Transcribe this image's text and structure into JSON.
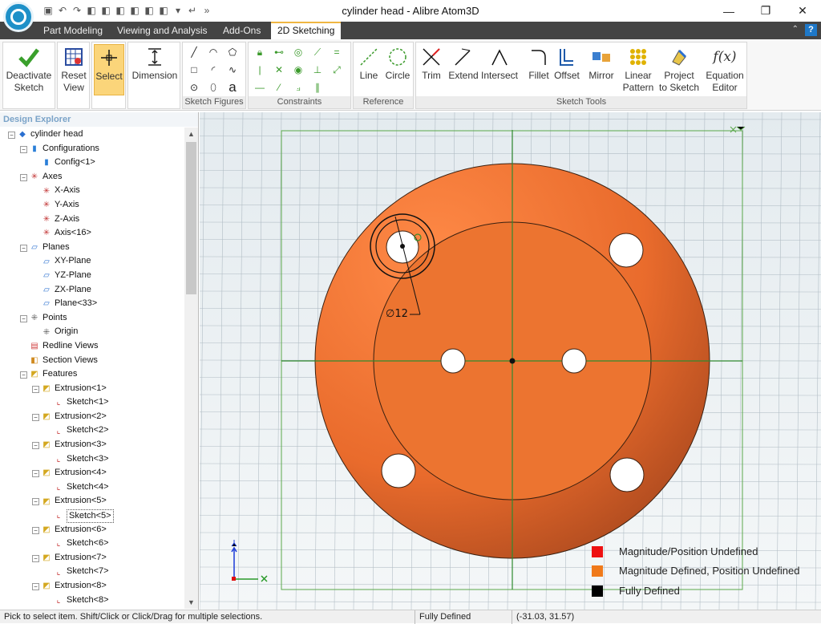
{
  "window": {
    "title": "cylinder head - Alibre Atom3D",
    "minimize_icon": "minimize-icon",
    "maximize_icon": "restore-icon",
    "close_icon": "close-icon"
  },
  "quick_access": [
    "save-icon",
    "undo-icon",
    "redo-icon",
    "cube-icon",
    "cube-icon",
    "cube-icon",
    "cube-icon",
    "cube-icon",
    "cube-icon",
    "dropdown-icon",
    "return-icon",
    "more-icon"
  ],
  "tabs": [
    {
      "label": "Part Modeling",
      "active": false
    },
    {
      "label": "Viewing and Analysis",
      "active": false
    },
    {
      "label": "Add-Ons",
      "active": false
    },
    {
      "label": "2D Sketching",
      "active": true
    }
  ],
  "ribbon": {
    "deactivate": "Deactivate\nSketch",
    "reset_view": "Reset\nView",
    "select": "Select",
    "dimension": "Dimension",
    "groups": {
      "sketch_figures": "Sketch Figures",
      "constraints": "Constraints",
      "reference": "Reference",
      "sketch_tools": "Sketch Tools"
    },
    "reference_buttons": [
      "Line",
      "Circle"
    ],
    "tool_buttons": [
      "Trim",
      "Extend",
      "Intersect",
      "Fillet",
      "Offset",
      "Mirror",
      "Linear\nPattern",
      "Project\nto Sketch",
      "Equation\nEditor"
    ]
  },
  "explorer": {
    "title": "Design Explorer",
    "tree": [
      {
        "label": "cylinder head",
        "level": 0,
        "exp": "-",
        "icon": "part"
      },
      {
        "label": "Configurations",
        "level": 1,
        "exp": "-",
        "icon": "config"
      },
      {
        "label": "Config<1>",
        "level": 2,
        "exp": "",
        "icon": "config"
      },
      {
        "label": "Axes",
        "level": 1,
        "exp": "-",
        "icon": "axis"
      },
      {
        "label": "X-Axis",
        "level": 2,
        "exp": "",
        "icon": "axis"
      },
      {
        "label": "Y-Axis",
        "level": 2,
        "exp": "",
        "icon": "axis"
      },
      {
        "label": "Z-Axis",
        "level": 2,
        "exp": "",
        "icon": "axis"
      },
      {
        "label": "Axis<16>",
        "level": 2,
        "exp": "",
        "icon": "axis"
      },
      {
        "label": "Planes",
        "level": 1,
        "exp": "-",
        "icon": "plane"
      },
      {
        "label": "XY-Plane",
        "level": 2,
        "exp": "",
        "icon": "plane"
      },
      {
        "label": "YZ-Plane",
        "level": 2,
        "exp": "",
        "icon": "plane"
      },
      {
        "label": "ZX-Plane",
        "level": 2,
        "exp": "",
        "icon": "plane"
      },
      {
        "label": "Plane<33>",
        "level": 2,
        "exp": "",
        "icon": "plane"
      },
      {
        "label": "Points",
        "level": 1,
        "exp": "-",
        "icon": "point"
      },
      {
        "label": "Origin",
        "level": 2,
        "exp": "",
        "icon": "point"
      },
      {
        "label": "Redline Views",
        "level": 1,
        "exp": "",
        "icon": "redline"
      },
      {
        "label": "Section Views",
        "level": 1,
        "exp": "",
        "icon": "section"
      },
      {
        "label": "Features",
        "level": 1,
        "exp": "-",
        "icon": "feature"
      },
      {
        "label": "Extrusion<1>",
        "level": 2,
        "exp": "-",
        "icon": "feature"
      },
      {
        "label": "Sketch<1>",
        "level": 3,
        "exp": "",
        "icon": "sketch"
      },
      {
        "label": "Extrusion<2>",
        "level": 2,
        "exp": "-",
        "icon": "feature"
      },
      {
        "label": "Sketch<2>",
        "level": 3,
        "exp": "",
        "icon": "sketch"
      },
      {
        "label": "Extrusion<3>",
        "level": 2,
        "exp": "-",
        "icon": "feature"
      },
      {
        "label": "Sketch<3>",
        "level": 3,
        "exp": "",
        "icon": "sketch"
      },
      {
        "label": "Extrusion<4>",
        "level": 2,
        "exp": "-",
        "icon": "feature"
      },
      {
        "label": "Sketch<4>",
        "level": 3,
        "exp": "",
        "icon": "sketch"
      },
      {
        "label": "Extrusion<5>",
        "level": 2,
        "exp": "-",
        "icon": "feature"
      },
      {
        "label": "Sketch<5>",
        "level": 3,
        "exp": "",
        "icon": "sketch",
        "highlight": true
      },
      {
        "label": "Extrusion<6>",
        "level": 2,
        "exp": "-",
        "icon": "feature"
      },
      {
        "label": "Sketch<6>",
        "level": 3,
        "exp": "",
        "icon": "sketch"
      },
      {
        "label": "Extrusion<7>",
        "level": 2,
        "exp": "-",
        "icon": "feature"
      },
      {
        "label": "Sketch<7>",
        "level": 3,
        "exp": "",
        "icon": "sketch"
      },
      {
        "label": "Extrusion<8>",
        "level": 2,
        "exp": "-",
        "icon": "feature"
      },
      {
        "label": "Sketch<8>",
        "level": 3,
        "exp": "",
        "icon": "sketch"
      }
    ]
  },
  "viewport": {
    "dimension_label": "∅12",
    "legend": [
      {
        "label": "Magnitude/Position Undefined",
        "color": "#ee1111"
      },
      {
        "label": "Magnitude Defined, Position Undefined",
        "color": "#f07a1a"
      },
      {
        "label": "Fully Defined",
        "color": "#000000"
      }
    ]
  },
  "status": {
    "hint": "Pick to select item. Shift/Click or Click/Drag for multiple selections.",
    "state": "Fully Defined",
    "coords": "(-31.03, 31.57)"
  }
}
